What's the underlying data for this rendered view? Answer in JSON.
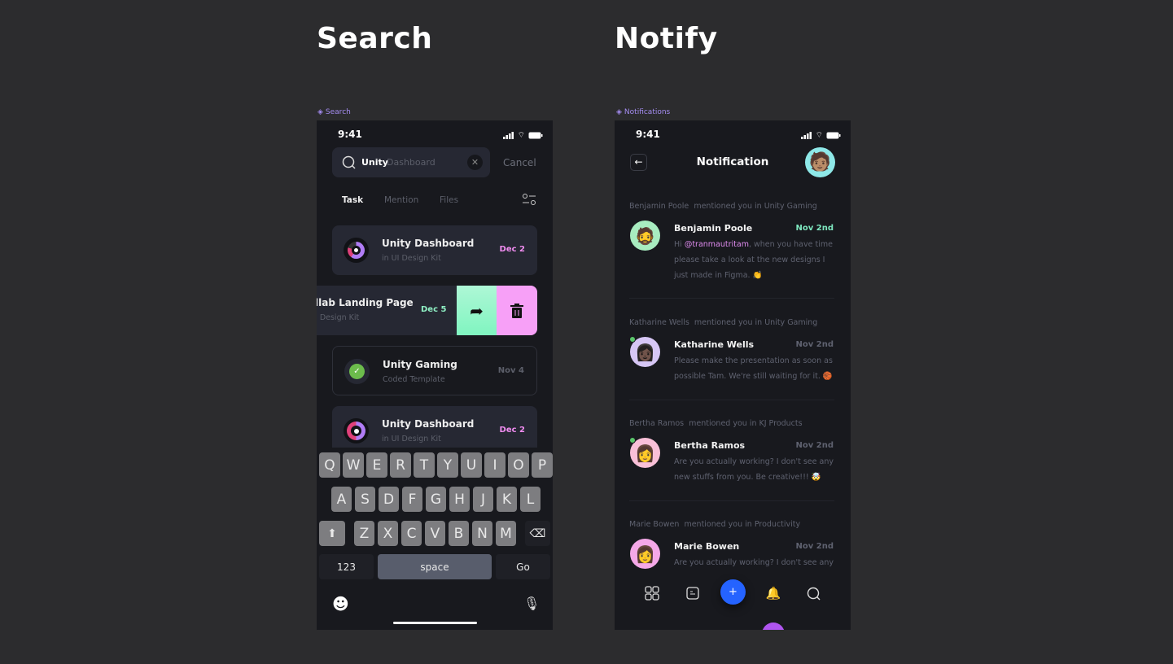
{
  "sections": {
    "search_title": "Search",
    "notify_title": "Notify"
  },
  "frames": {
    "search_label": "Search",
    "notify_label": "Notifications"
  },
  "status": {
    "time": "9:41"
  },
  "search": {
    "query_typed": "Unity",
    "query_suggest": "Dashboard",
    "cancel_label": "Cancel",
    "tabs": [
      {
        "label": "Task",
        "active": true
      },
      {
        "label": "Mention",
        "active": false
      },
      {
        "label": "Files",
        "active": false
      }
    ],
    "results": [
      {
        "title": "Unity Dashboard",
        "subtitle": "in UI Design Kit",
        "date": "Dec 2",
        "date_color": "#f08cf0"
      },
      {
        "title": "llab Landing Page",
        "subtitle": "I Design Kit",
        "date": "Dec 5",
        "date_color": "#8ff0c4",
        "swiped": true
      },
      {
        "title": "Unity Gaming",
        "subtitle": "Coded Template",
        "date": "Nov 4",
        "date_color": "#5c5f6a",
        "completed": true
      },
      {
        "title": "Unity Dashboard",
        "subtitle": "in UI Design Kit",
        "date": "Dec 2",
        "date_color": "#f08cf0"
      }
    ],
    "swipe_actions": [
      {
        "icon": "share-icon",
        "color": "#8ef5c7"
      },
      {
        "icon": "trash-icon",
        "color": "#f7a0f7"
      }
    ]
  },
  "keyboard": {
    "row1": [
      "Q",
      "W",
      "E",
      "R",
      "T",
      "Y",
      "U",
      "I",
      "O",
      "P"
    ],
    "row2": [
      "A",
      "S",
      "D",
      "F",
      "G",
      "H",
      "J",
      "K",
      "L"
    ],
    "row3": [
      "Z",
      "X",
      "C",
      "V",
      "B",
      "N",
      "M"
    ],
    "numbers_label": "123",
    "space_label": "space",
    "go_label": "Go"
  },
  "notifications": {
    "title": "Notification",
    "items": [
      {
        "header_name": "Benjamin Poole",
        "header_text": "mentioned you in Unity Gaming",
        "name": "Benjamin Poole",
        "date": "Nov 2nd",
        "date_color": "#7ee8c0",
        "mention": "@tranmautritam",
        "message_pre": "Hi ",
        "message": ", when you have time please take a look at the new designs I just made in Figma. 👏",
        "avatar_bg": "#a8ecc0",
        "avatar": "🧔",
        "online": false
      },
      {
        "header_name": "Katharine Wells",
        "header_text": "mentioned you in Unity Gaming",
        "name": "Katharine Wells",
        "date": "Nov 2nd",
        "date_color": "#5f6270",
        "message": "Please make the presentation as soon as possible Tam. We're still waiting for it. 🏀",
        "avatar_bg": "#d6c6f5",
        "avatar": "👩🏿",
        "online": true
      },
      {
        "header_name": "Bertha Ramos",
        "header_text": "mentioned you in KJ Products",
        "name": "Bertha Ramos",
        "date": "Nov 2nd",
        "date_color": "#5f6270",
        "message": "Are you actually working? I don't see any new stuffs from you. Be creative!!! 🤯",
        "avatar_bg": "#f9c0d8",
        "avatar": "👩",
        "online": true
      },
      {
        "header_name": "Marie Bowen",
        "header_text": "mentioned you in Productivity",
        "name": "Marie Bowen",
        "date": "Nov 2nd",
        "date_color": "#5f6270",
        "message": "Are you actually working? I don't see any",
        "avatar_bg": "#f5a8e8",
        "avatar": "👩",
        "online": false
      }
    ],
    "nav": [
      "grid-icon",
      "document-icon",
      "plus-icon",
      "bell-icon",
      "search-icon"
    ],
    "fab_label": "+",
    "accent": "#2563ff"
  }
}
